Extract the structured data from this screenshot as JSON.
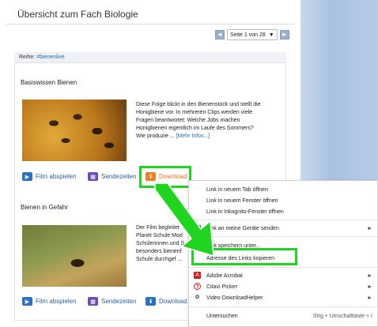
{
  "page": {
    "title": "Übersicht zum Fach Biologie"
  },
  "pager": {
    "prev_icon": "chevron-left-icon",
    "next_icon": "chevron-right-icon",
    "prev_glyph": "◄",
    "next_glyph": "►",
    "current": "Seite 1 von 28",
    "dropdown_glyph": "▼"
  },
  "series": {
    "label": "Reihe:",
    "tag": "#bienenlive"
  },
  "episodes": [
    {
      "title": "Basiswissen Bienen",
      "description_lines": [
        "Diese Folge blickt in den Bienenstock und stellt die",
        "Honigbiene vor. In mehreren Clips werden viele",
        "Fragen beantwortet: Welche Jobs machen",
        "Honigbienen eigentlich im Laufe des Sommers?",
        "Wie produzie ..."
      ],
      "more_link": "[Mehr Infos...]",
      "actions": {
        "play": "Film abspielen",
        "schedule": "Sendezeiten",
        "download": "Download"
      }
    },
    {
      "title": "Bienen in Gefahr",
      "description_lines": [
        "Der Film begleitet",
        "Planet Schule Mod",
        "Schülerinnen und S",
        "besonders bienenf",
        "Schule durchgef ..."
      ],
      "actions": {
        "play": "Film abspielen",
        "schedule": "Sendezeiten",
        "download": "Download"
      }
    }
  ],
  "context_menu": {
    "items": [
      {
        "label": "Link in neuem Tab öffnen"
      },
      {
        "label": "Link in neuem Fenster öffnen"
      },
      {
        "label": "Link in Inkognito-Fenster öffnen"
      },
      {
        "label": "Link an meine Geräte senden",
        "icon": "device-icon",
        "submenu": "►"
      },
      {
        "label": "Link speichern unter..."
      },
      {
        "label": "Adresse des Links kopieren"
      },
      {
        "label": "Adobe Acrobat",
        "icon": "acrobat-icon",
        "submenu": "►"
      },
      {
        "label": "Citavi Picker",
        "icon": "citavi-icon",
        "submenu": "►"
      },
      {
        "label": "Video DownloadHelper",
        "icon": "video-downloadhelper-icon",
        "submenu": "►"
      },
      {
        "label": "Untersuchen",
        "shortcut": "Strg + Umschalttaste + I"
      }
    ]
  },
  "annotation": {
    "highlight_color": "#1fd51f"
  }
}
